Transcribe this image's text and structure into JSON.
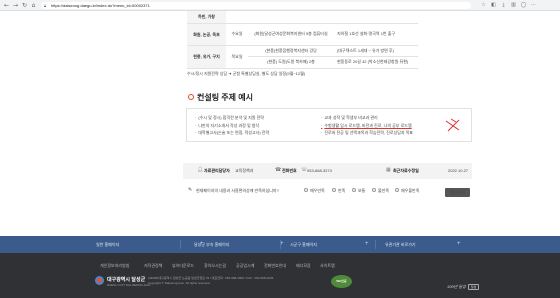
{
  "browser": {
    "url": "https://dalseong.daegu.kr/index.do?menu_id=00002371"
  },
  "schedule": [
    {
      "name": "하빈, 가창",
      "day": "",
      "place": "",
      "note": ""
    },
    {
      "name": "화원, 논공, 옥포",
      "day": "수요일",
      "place": "(화원)달성군여성문화복지센터 5층 컴퓨터실",
      "note": "지하철 1호선 설화·명곡역 1번 출구"
    },
    {
      "name": "",
      "day": "목요일",
      "place": "(현풍)현풍읍행정복지센터 강당",
      "note": "(대구텍스트 1세대 ~ 유가 방면 후)"
    },
    {
      "name": "현풍, 유가, 구지",
      "day": "",
      "place": "(현풍) 도원(도원 북카페) 2층",
      "note": "현풍동로 20길 42 (박소신한태강창원 뒤편)"
    }
  ],
  "schedule_note": "수시/정시 지원전략 상담 ➜ 군청 특별상담실, 별도 상담 일정(9월~12월)",
  "section": {
    "title": "컨설팅 주제 예시",
    "left_items": [
      "(수시 및 정시) 합격전 분석 및 지원 전략",
      "나만의 자기소개서 작성 과정 및 첨삭",
      "대학별고사(논술 또는 면접, 적성고사) 전략"
    ],
    "right_items": [
      "교과 성적 및 학생부 비교과 관리",
      "수험생활 입시 로드맵, 비전과 진로, 나의 공부 로드맵",
      "진로와 전공 및 선택과목과 학습전략, 진로상담과 목표"
    ]
  },
  "manager": {
    "dept_label": "자료관리담당자",
    "dept_value": "교육정책과",
    "phone_label": "전화번호",
    "phone_value": "053-668-3274",
    "date_label": "최근자료수정일",
    "date_value": "2022.10.27"
  },
  "survey": {
    "question": "현재페이지의 내용과 사용편의성에 만족하십니까?",
    "options": [
      "매우만족",
      "만족",
      "보통",
      "불만족",
      "매우불만족"
    ],
    "button": "평가하기"
  },
  "link_bar": [
    "일반 홈페이지",
    "달성군 부속 홈페이지",
    "시군구 홈페이지",
    "유관기관 바로가기"
  ],
  "footer": {
    "links": [
      "개인정보처리방침",
      "저작권정책",
      "뷰어다운로드",
      "찾아오시는길",
      "공공업시계",
      "전화번호안내",
      "배너모음",
      "사이트맵"
    ],
    "org_name": "대구광역시 달성군",
    "org_en": "DAEGU CITY DALSEONG-GUN",
    "address": "(43008)대구광역시 달성군 논공읍 달성군청로 33 / 대표전화 : 053-668-2000 / FAX : 053-668-2035",
    "copyright": "Copyright © Dalseong-Gun. All rights reserved.",
    "badge": "WA인증",
    "slogan": "100년 달성",
    "slogan_tag": "달성"
  },
  "icons": {
    "back": "back-arrow-icon",
    "forward": "forward-arrow-icon",
    "reload": "reload-icon",
    "home": "home-icon",
    "lock": "lock-icon",
    "user": "user-icon",
    "phone": "phone-icon",
    "calendar": "calendar-icon",
    "survey": "survey-icon"
  },
  "colors": {
    "accent": "#e8452c",
    "link_bar": "#3a5b8c",
    "footer": "#2f3134"
  }
}
